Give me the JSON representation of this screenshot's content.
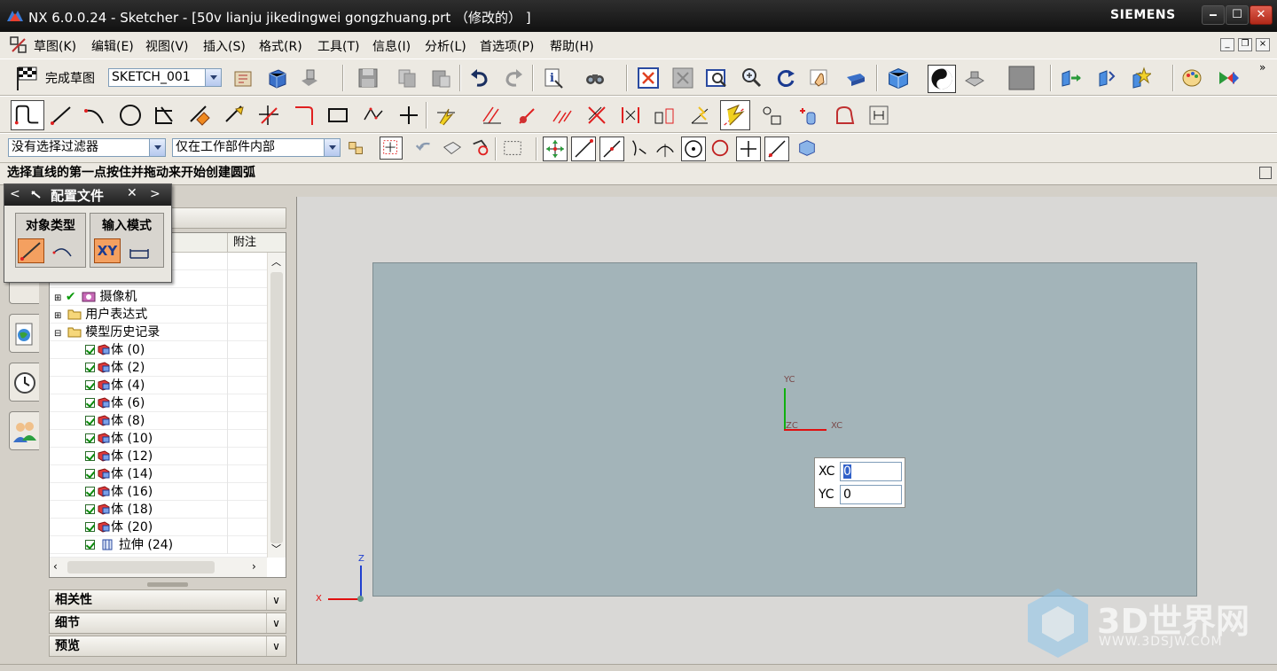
{
  "title_bar": {
    "title": "NX 6.0.0.24 - Sketcher - [50v lianju jikedingwei gongzhuang.prt （修改的） ]",
    "brand": "SIEMENS",
    "minimize_glyph": "🗕",
    "maximize_glyph": "☐",
    "close_glyph": "✕"
  },
  "menu": {
    "items": [
      "草图(K)",
      "编辑(E)",
      "视图(V)",
      "插入(S)",
      "格式(R)",
      "工具(T)",
      "信息(I)",
      "分析(L)",
      "首选项(P)",
      "帮助(H)"
    ]
  },
  "toolbar1": {
    "finish_sketch_label": "完成草图",
    "sketch_name": "SKETCH_001"
  },
  "toolbar3": {
    "filter_value": "没有选择过滤器",
    "scope_value": "仅在工作部件内部"
  },
  "status": {
    "prompt": "选择直线的第一点按住并拖动来开始创建圆弧"
  },
  "popup": {
    "title": "配置文件",
    "group1_label": "对象类型",
    "group2_label": "输入模式",
    "xy_label": "XY",
    "nav_prev": "<",
    "nav_next": ">",
    "close_glyph": "✕"
  },
  "navigator": {
    "column_note": "附注",
    "camera": "摄像机",
    "user_expressions": "用户表达式",
    "model_history": "模型历史记录",
    "bodies": [
      "体 (0)",
      "体 (2)",
      "体 (4)",
      "体 (6)",
      "体 (8)",
      "体 (10)",
      "体 (12)",
      "体 (14)",
      "体 (16)",
      "体 (18)",
      "体 (20)"
    ],
    "extrude": "拉伸 (24)",
    "sections": [
      "相关性",
      "细节",
      "预览"
    ]
  },
  "canvas": {
    "wcs_y": "YC",
    "wcs_x": "XC",
    "wcs_z": "ZC",
    "abs_z": "Z",
    "abs_x": "X",
    "input_xc_label": "XC",
    "input_xc_value": "0",
    "input_yc_label": "YC",
    "input_yc_value": "0"
  },
  "watermark": {
    "brand": "3D世界网",
    "url": "WWW.3DSJW.COM"
  },
  "colors": {
    "title_bg": "#1a1a1a",
    "sheet": "#a3b4b9",
    "axis_x": "#e01010",
    "axis_y": "#10b010",
    "axis_z": "#2040d0"
  }
}
